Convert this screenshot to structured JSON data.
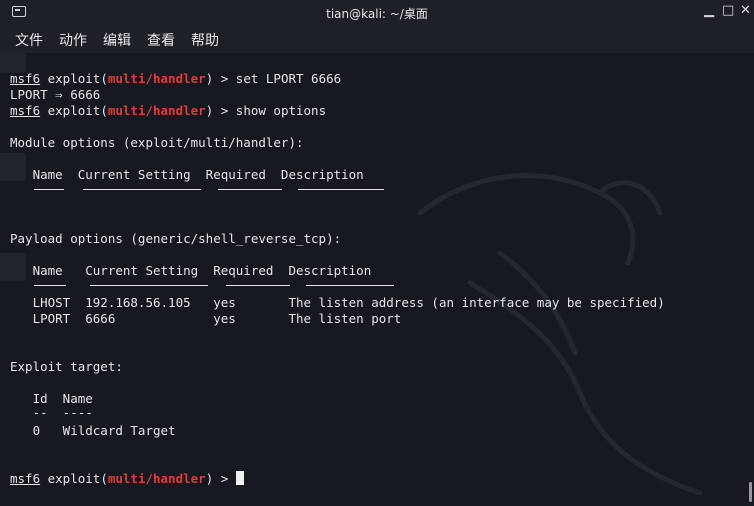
{
  "window": {
    "title": "tian@kali: ~/桌面",
    "min": "▁",
    "max": "□",
    "close": "✕"
  },
  "menu": [
    "文件",
    "动作",
    "编辑",
    "查看",
    "帮助"
  ],
  "prompt": {
    "msf": "msf6",
    "pre": " exploit(",
    "module": "multi/handler",
    "post": ") > "
  },
  "lines": {
    "cmd1": "set LPORT 6666",
    "out1": "LPORT ⇒ 6666",
    "cmd2": "show options",
    "module_opts": "Module options (exploit/multi/handler):",
    "mod_header": "   Name  Current Setting  Required  Description",
    "payload_opts": "Payload options (generic/shell_reverse_tcp):",
    "pay_header": "   Name   Current Setting  Required  Description",
    "pay_row1": "   LHOST  192.168.56.105   yes       The listen address (an interface may be specified)",
    "pay_row2": "   LPORT  6666             yes       The listen port",
    "exploit_target": "Exploit target:",
    "tgt_header": "   Id  Name",
    "tgt_under": "   --  ----",
    "tgt_row": "   0   Wildcard Target"
  }
}
